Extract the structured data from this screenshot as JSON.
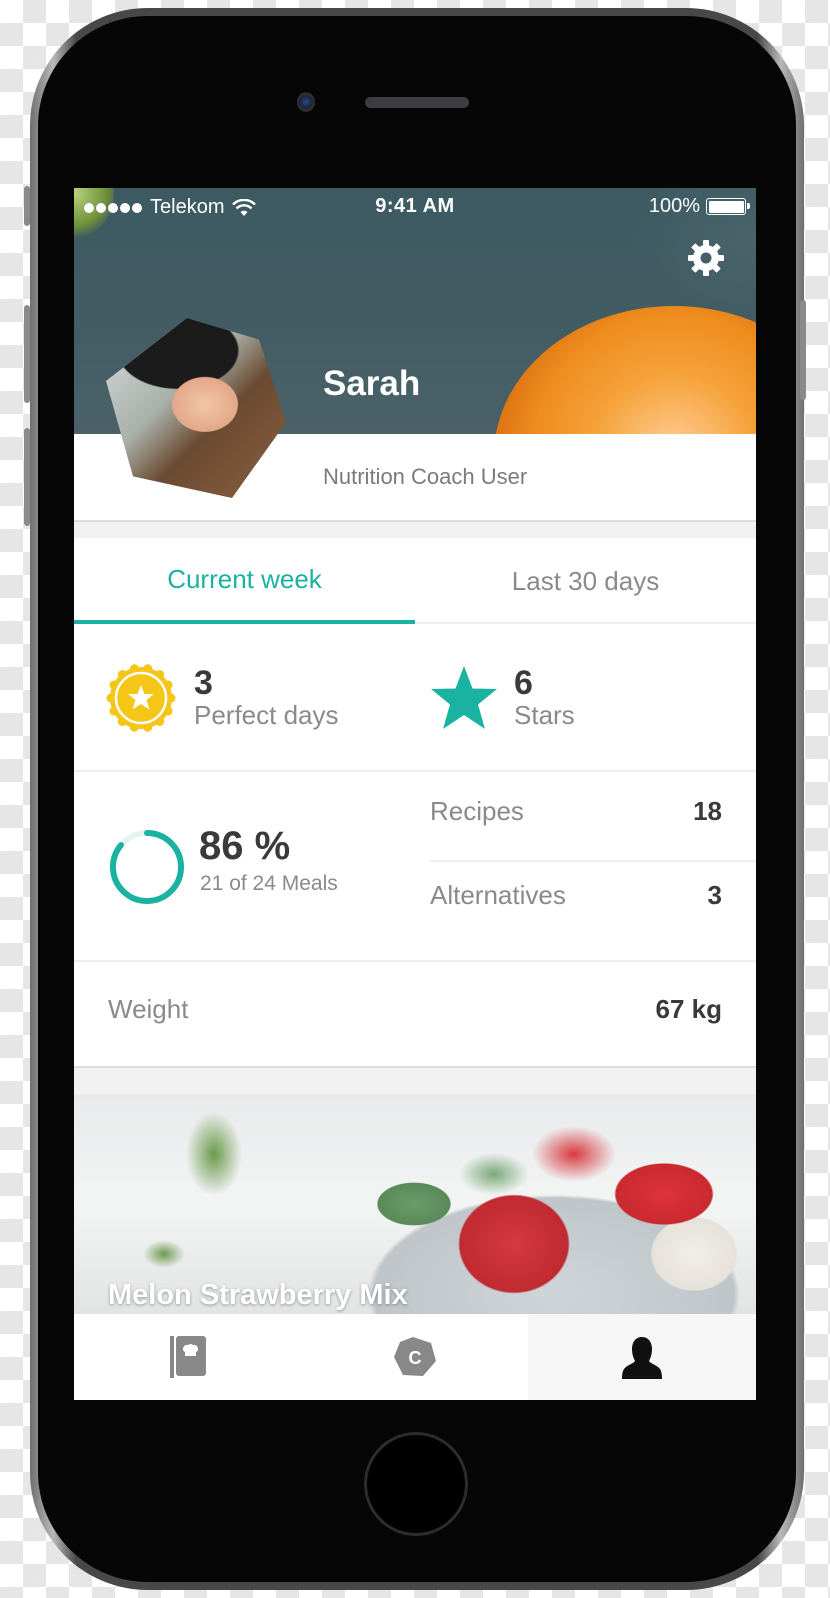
{
  "status_bar": {
    "carrier": "Telekom",
    "signal_dots": 5,
    "wifi_icon": "wifi-icon",
    "time": "9:41 AM",
    "battery": "100%"
  },
  "profile": {
    "name": "Sarah",
    "role": "Nutrition Coach User",
    "settings_icon": "gear-icon"
  },
  "tabs": [
    {
      "label": "Current week",
      "active": true
    },
    {
      "label": "Last 30 days",
      "active": false
    }
  ],
  "stats": {
    "perfect_days": {
      "value": "3",
      "label": "Perfect days",
      "icon": "medal-star-icon"
    },
    "stars": {
      "value": "6",
      "label": "Stars",
      "icon": "star-icon"
    },
    "meals": {
      "percent_label": "86 %",
      "progress_fraction": 0.86,
      "detail": "21 of 24 Meals"
    },
    "recipes": {
      "label": "Recipes",
      "value": "18"
    },
    "alternatives": {
      "label": "Alternatives",
      "value": "3"
    },
    "weight": {
      "label": "Weight",
      "value": "67 kg"
    }
  },
  "recipe_card": {
    "title": "Melon Strawberry Mix"
  },
  "tab_bar": [
    {
      "icon": "recipe-book-icon",
      "active": false
    },
    {
      "icon": "coach-hexagon-icon",
      "glyph": "C",
      "active": false
    },
    {
      "icon": "profile-person-icon",
      "active": true
    }
  ],
  "colors": {
    "accent": "#1ab2a0",
    "medal": "#f5c518",
    "text_dark": "#3a3a3a",
    "text_muted": "#8a8a8a"
  }
}
